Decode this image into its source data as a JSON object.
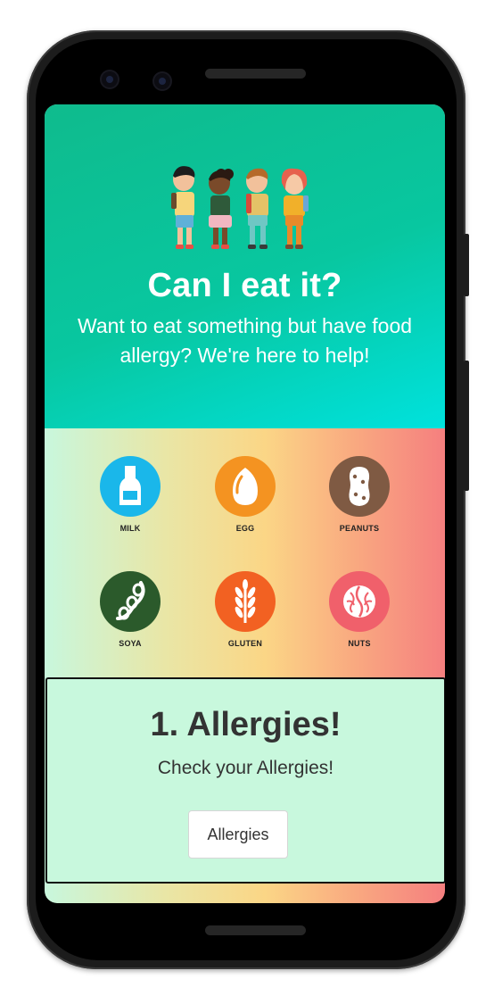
{
  "hero": {
    "title": "Can I eat it?",
    "subtitle": "Want to eat something but have food allergy? We're here to help!",
    "gradient_start": "#0fbb8d",
    "gradient_end": "#00e2dd"
  },
  "allergens": [
    {
      "label": "MILK",
      "icon": "milk-bottle-icon",
      "color": "#1ab7ea"
    },
    {
      "label": "EGG",
      "icon": "egg-icon",
      "color": "#f49321"
    },
    {
      "label": "PEANUTS",
      "icon": "peanut-icon",
      "color": "#7f5a43"
    },
    {
      "label": "SOYA",
      "icon": "soy-bean-icon",
      "color": "#2b5a2b"
    },
    {
      "label": "GLUTEN",
      "icon": "wheat-icon",
      "color": "#f26122"
    },
    {
      "label": "NUTS",
      "icon": "walnut-icon",
      "color": "#f0606b"
    }
  ],
  "card": {
    "title": "1. Allergies!",
    "subtitle": "Check your Allergies!",
    "button_label": "Allergies",
    "background": "#c8f8dd"
  }
}
